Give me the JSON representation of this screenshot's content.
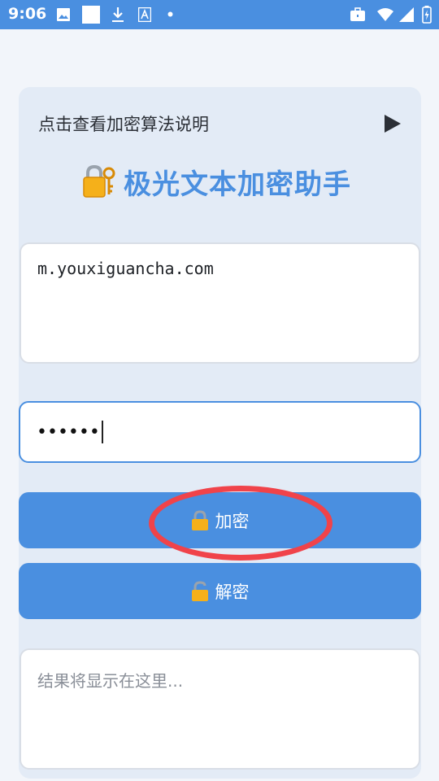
{
  "status_bar": {
    "time": "9:06"
  },
  "intro": {
    "label": "点击查看加密算法说明",
    "arrow_icon": "play-triangle-icon"
  },
  "app": {
    "title": "极光文本加密助手",
    "title_icon": "lock-with-key-icon"
  },
  "input_text": {
    "value": "m.youxiguancha.com"
  },
  "password": {
    "value": "••••••"
  },
  "buttons": {
    "encrypt_label": "加密",
    "decrypt_label": "解密"
  },
  "result": {
    "placeholder": "结果将显示在这里..."
  },
  "colors": {
    "accent": "#4a8fe0",
    "card": "#e3ebf6",
    "highlight": "#f0434a"
  }
}
